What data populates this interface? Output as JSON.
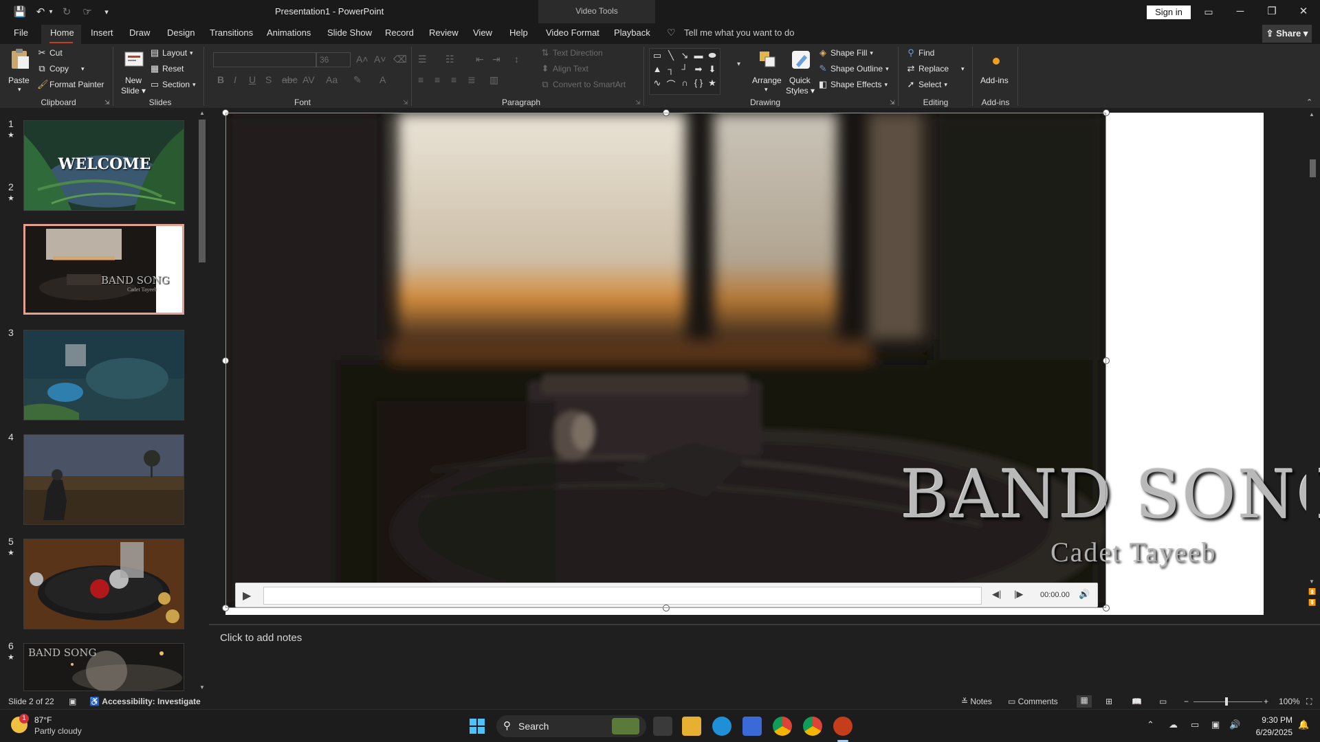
{
  "window": {
    "title": "Presentation1  -  PowerPoint",
    "contextual_tab_group": "Video Tools",
    "signin_label": "Sign in",
    "minimize_glyph": "─",
    "restore_glyph": "❐",
    "close_glyph": "✕"
  },
  "quick_access": {
    "save_glyph": "💾",
    "undo_glyph": "↶",
    "redo_glyph": "↻",
    "customize_glyph": "▾"
  },
  "tabs": [
    {
      "label": "File"
    },
    {
      "label": "Home"
    },
    {
      "label": "Insert"
    },
    {
      "label": "Draw"
    },
    {
      "label": "Design"
    },
    {
      "label": "Transitions"
    },
    {
      "label": "Animations"
    },
    {
      "label": "Slide Show"
    },
    {
      "label": "Record"
    },
    {
      "label": "Review"
    },
    {
      "label": "View"
    },
    {
      "label": "Help"
    },
    {
      "label": "Video Format"
    },
    {
      "label": "Playback"
    }
  ],
  "active_tab": "Home",
  "tell_me": "Tell me what you want to do",
  "share_label": "Share",
  "ribbon": {
    "clipboard": {
      "label": "Clipboard",
      "paste": "Paste",
      "cut": "Cut",
      "copy": "Copy",
      "format_painter": "Format Painter"
    },
    "slides": {
      "label": "Slides",
      "new_slide_1": "New",
      "new_slide_2": "Slide",
      "layout": "Layout",
      "reset": "Reset",
      "section": "Section"
    },
    "font": {
      "label": "Font",
      "font_name": "",
      "font_size": "36"
    },
    "paragraph": {
      "label": "Paragraph",
      "text_direction": "Text Direction",
      "align_text": "Align Text",
      "convert_smartart": "Convert to SmartArt"
    },
    "drawing": {
      "label": "Drawing",
      "arrange": "Arrange",
      "quick_styles_1": "Quick",
      "quick_styles_2": "Styles",
      "shape_fill": "Shape Fill",
      "shape_outline": "Shape Outline",
      "shape_effects": "Shape Effects"
    },
    "editing": {
      "label": "Editing",
      "find": "Find",
      "replace": "Replace",
      "select": "Select"
    },
    "addins": {
      "label": "Add-ins",
      "button": "Add-ins"
    }
  },
  "thumbnails": [
    {
      "number": "1",
      "star": "★",
      "caption": "WELCOME"
    },
    {
      "number": "2",
      "star": "★",
      "caption": "BAND SONG",
      "subcaption": "Cadet Tayeeb"
    },
    {
      "number": "3",
      "star": ""
    },
    {
      "number": "4",
      "star": ""
    },
    {
      "number": "5",
      "star": "★"
    },
    {
      "number": "6",
      "star": "★",
      "caption": "BAND SONG"
    }
  ],
  "slide": {
    "title": "BAND SONG",
    "subtitle": "Cadet Tayeeb"
  },
  "player": {
    "timecode": "00:00.00",
    "progress": 0
  },
  "notes_placeholder": "Click to add notes",
  "status": {
    "slide_counter": "Slide 2 of 22",
    "accessibility": "Accessibility: Investigate",
    "notes": "Notes",
    "comments": "Comments",
    "zoom": "100%"
  },
  "taskbar": {
    "weather_temp": "87°F",
    "weather_desc": "Partly cloudy",
    "weather_badge": "1",
    "search": "Search",
    "time": "9:30 PM",
    "date": "6/29/2025"
  },
  "colors": {
    "accent": "#c43e1c",
    "selection_border": "#e6a08f",
    "ribbon_bg": "#2b2b2b",
    "window_bg": "#1a1a1a"
  }
}
